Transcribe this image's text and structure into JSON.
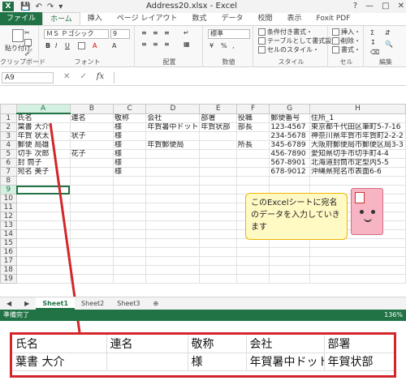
{
  "window": {
    "title": "Address20.xlsx - Excel",
    "logo": "X",
    "qat_icons": [
      "save-icon",
      "undo-icon",
      "redo-icon",
      "customize-icon"
    ],
    "controls": [
      "?",
      "—",
      "□",
      "✕"
    ]
  },
  "ribbon_tabs": [
    "ファイル",
    "ホーム",
    "挿入",
    "ページ レイアウト",
    "数式",
    "データ",
    "校閲",
    "表示",
    "Foxit PDF"
  ],
  "ribbon": {
    "clipboard": {
      "label": "クリップボード",
      "paste": "貼り付け"
    },
    "font": {
      "label": "フォント",
      "font_name": "ＭＳ Ｐゴシック",
      "font_size": "9",
      "bold": "B",
      "italic": "I",
      "underline": "U",
      "grow": "A",
      "shrink": "A",
      "color": "A"
    },
    "alignment": {
      "label": "配置"
    },
    "number": {
      "label": "数値",
      "format": "標準",
      "percent": "%",
      "comma": ","
    },
    "styles": {
      "label": "スタイル",
      "conditional": "条件付き書式・",
      "table": "テーブルとして書式設定・",
      "cell": "セルのスタイル・"
    },
    "cells": {
      "label": "セル",
      "insert": "挿入・",
      "delete": "削除・",
      "format": "書式・"
    },
    "editing": {
      "label": "編集"
    }
  },
  "formula_bar": {
    "name_box": "A9",
    "cancel": "✕",
    "enter": "✓",
    "fx": "fx",
    "value": ""
  },
  "sheet": {
    "columns": [
      "A",
      "B",
      "C",
      "D",
      "E",
      "F",
      "G",
      "H"
    ],
    "selected_column": "A",
    "selected_row": "9",
    "rows": [
      {
        "num": "1",
        "cells": [
          "氏名",
          "連名",
          "敬称",
          "会社",
          "部署",
          "役職",
          "郵便番号",
          "住所_1"
        ]
      },
      {
        "num": "2",
        "cells": [
          "葉書 大介",
          "",
          "様",
          "年賀暑中ドット",
          "年賀状部",
          "部長",
          "123-4567",
          "東京都千代田区筆町5-7-16"
        ]
      },
      {
        "num": "3",
        "cells": [
          "年賀 状太",
          "状子",
          "様",
          "",
          "",
          "",
          "234-5678",
          "神奈川県年賀市年賀町2-2-2"
        ]
      },
      {
        "num": "4",
        "cells": [
          "郵便 局雄",
          "",
          "様",
          "年賀郵便局",
          "",
          "所長",
          "345-6789",
          "大阪府郵便局市郵便区局3-3"
        ]
      },
      {
        "num": "5",
        "cells": [
          "切手 次郎",
          "花子",
          "様",
          "",
          "",
          "",
          "456-7890",
          "愛知県切手市切手町4-4"
        ]
      },
      {
        "num": "6",
        "cells": [
          "封 筒子",
          "",
          "様",
          "",
          "",
          "",
          "567-8901",
          "北海道封筒市定型内5-5"
        ]
      },
      {
        "num": "7",
        "cells": [
          "宛名 美子",
          "",
          "様",
          "",
          "",
          "",
          "678-9012",
          "沖縄県宛名市表面6-6"
        ]
      },
      {
        "num": "8",
        "cells": [
          "",
          "",
          "",
          "",
          "",
          "",
          "",
          ""
        ]
      },
      {
        "num": "9",
        "cells": [
          "",
          "",
          "",
          "",
          "",
          "",
          "",
          ""
        ]
      },
      {
        "num": "10",
        "cells": [
          "",
          "",
          "",
          "",
          "",
          "",
          "",
          ""
        ]
      },
      {
        "num": "11",
        "cells": [
          "",
          "",
          "",
          "",
          "",
          "",
          "",
          ""
        ]
      },
      {
        "num": "12",
        "cells": [
          "",
          "",
          "",
          "",
          "",
          "",
          "",
          ""
        ]
      },
      {
        "num": "13",
        "cells": [
          "",
          "",
          "",
          "",
          "",
          "",
          "",
          ""
        ]
      },
      {
        "num": "14",
        "cells": [
          "",
          "",
          "",
          "",
          "",
          "",
          "",
          ""
        ]
      },
      {
        "num": "15",
        "cells": [
          "",
          "",
          "",
          "",
          "",
          "",
          "",
          ""
        ]
      },
      {
        "num": "16",
        "cells": [
          "",
          "",
          "",
          "",
          "",
          "",
          "",
          ""
        ]
      },
      {
        "num": "17",
        "cells": [
          "",
          "",
          "",
          "",
          "",
          "",
          "",
          ""
        ]
      },
      {
        "num": "18",
        "cells": [
          "",
          "",
          "",
          "",
          "",
          "",
          "",
          ""
        ]
      },
      {
        "num": "19",
        "cells": [
          "",
          "",
          "",
          "",
          "",
          "",
          "",
          ""
        ]
      }
    ]
  },
  "sheet_tabs": [
    "Sheet1",
    "Sheet2",
    "Sheet3"
  ],
  "add_sheet": "⊕",
  "status": {
    "ready": "準備完了",
    "zoom": "136%"
  },
  "callout": {
    "text": "このExcelシートに宛名のデータを入力していきます"
  },
  "zoom_view": {
    "rows": [
      [
        "氏名",
        "連名",
        "敬称",
        "会社",
        "部署"
      ],
      [
        "葉書 大介",
        "",
        "様",
        "年賀暑中ドット",
        "年賀状部"
      ]
    ]
  },
  "colors": {
    "excel_green": "#217346",
    "callout_fill": "#fff9c4",
    "callout_border": "#f0b400",
    "highlight_red": "#d3262a"
  }
}
